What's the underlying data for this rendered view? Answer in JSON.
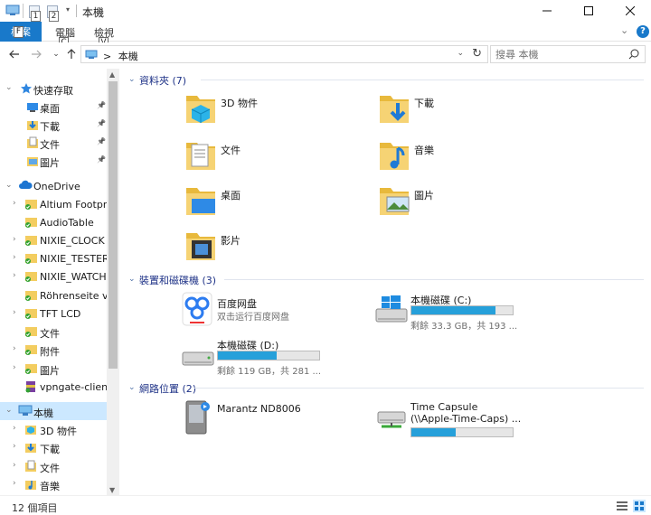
{
  "window": {
    "title": "本機",
    "qat_keytips": [
      "1",
      "2"
    ]
  },
  "ribbon": {
    "file_tab": "檔案",
    "file_keytip": "F",
    "tabs": [
      {
        "label": "電腦",
        "keytip": "C"
      },
      {
        "label": "檢視",
        "keytip": "V"
      }
    ],
    "help": "?"
  },
  "address": {
    "crumb": "本機",
    "separator": ">",
    "search_placeholder": "搜尋 本機"
  },
  "nav": {
    "items": [
      {
        "label": "快速存取",
        "icon": "star-icon",
        "pinned": false
      },
      {
        "label": "桌面",
        "icon": "desktop-folder-icon",
        "pinned": true
      },
      {
        "label": "下載",
        "icon": "downloads-folder-icon",
        "pinned": true
      },
      {
        "label": "文件",
        "icon": "documents-folder-icon",
        "pinned": true
      },
      {
        "label": "圖片",
        "icon": "pictures-folder-icon",
        "pinned": true
      },
      {
        "label": "OneDrive",
        "icon": "onedrive-cloud-icon",
        "pinned": false
      },
      {
        "label": "Altium Footprin",
        "icon": "sync-folder-icon",
        "pinned": false
      },
      {
        "label": "AudioTable",
        "icon": "sync-folder-icon",
        "pinned": false
      },
      {
        "label": "NIXIE_CLOCK",
        "icon": "sync-folder-icon",
        "pinned": false
      },
      {
        "label": "NIXIE_TESTER",
        "icon": "sync-folder-icon",
        "pinned": false
      },
      {
        "label": "NIXIE_WATCH",
        "icon": "sync-folder-icon",
        "pinned": false
      },
      {
        "label": "Röhrenseite vor",
        "icon": "sync-folder-icon",
        "pinned": false
      },
      {
        "label": "TFT LCD",
        "icon": "sync-folder-icon",
        "pinned": false
      },
      {
        "label": "文件",
        "icon": "sync-folder-icon",
        "pinned": false
      },
      {
        "label": "附件",
        "icon": "sync-folder-icon",
        "pinned": false
      },
      {
        "label": "圖片",
        "icon": "sync-folder-icon",
        "pinned": false
      },
      {
        "label": "vpngate-client-",
        "icon": "archive-icon",
        "pinned": false
      },
      {
        "label": "本機",
        "icon": "this-pc-icon",
        "pinned": false
      },
      {
        "label": "3D 物件",
        "icon": "3d-objects-folder-icon",
        "pinned": false
      },
      {
        "label": "下載",
        "icon": "downloads-folder-icon",
        "pinned": false
      },
      {
        "label": "文件",
        "icon": "documents-folder-icon",
        "pinned": false
      },
      {
        "label": "音樂",
        "icon": "music-folder-icon",
        "pinned": false
      }
    ]
  },
  "groups": {
    "folders": {
      "title": "資料夾",
      "count": "(7)"
    },
    "devices": {
      "title": "裝置和磁碟機",
      "count": "(3)"
    },
    "network": {
      "title": "網路位置",
      "count": "(2)"
    }
  },
  "folders": [
    {
      "name": "3D 物件",
      "icon": "3d-objects-folder-icon"
    },
    {
      "name": "下載",
      "icon": "downloads-folder-icon"
    },
    {
      "name": "文件",
      "icon": "documents-folder-icon"
    },
    {
      "name": "音樂",
      "icon": "music-folder-icon"
    },
    {
      "name": "桌面",
      "icon": "desktop-folder-icon"
    },
    {
      "name": "圖片",
      "icon": "pictures-folder-icon"
    },
    {
      "name": "影片",
      "icon": "videos-folder-icon"
    }
  ],
  "devices": [
    {
      "name": "百度网盘",
      "subtitle": "双击运行百度网盘",
      "icon": "baidu-netdisk-icon"
    },
    {
      "name": "本機磁碟 (C:)",
      "subtitle": "剩餘 33.3 GB，共 193 ...",
      "used_fraction": 0.83,
      "icon": "windows-drive-icon"
    },
    {
      "name": "本機磁碟 (D:)",
      "subtitle": "剩餘 119 GB，共 281 ...",
      "used_fraction": 0.58,
      "icon": "hard-drive-icon"
    }
  ],
  "network": [
    {
      "name": "Marantz ND8006",
      "subtitle": "",
      "icon": "media-device-icon"
    },
    {
      "name": "Time Capsule",
      "subtitle": "(\\\\Apple-Time-Caps) ...",
      "used_fraction": 0.44,
      "icon": "network-drive-icon"
    }
  ],
  "status": {
    "item_count": "12 個項目"
  }
}
